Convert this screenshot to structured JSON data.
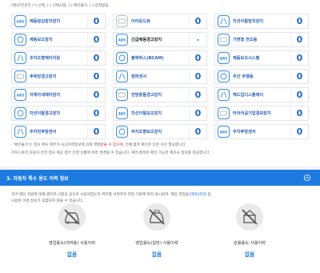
{
  "legend": "(제)안전운전 (*) 선택, (-) 선택사항, (-) 확인불가, (-) 장착없음",
  "options": [
    {
      "icon": "abs-icon",
      "label": "제동잠김방지장치",
      "count": "0",
      "label_color": "blue"
    },
    {
      "icon": "display-icon",
      "label": "어라운드뷰",
      "count": "0",
      "label_color": "blue"
    },
    {
      "icon": "lane-keep-icon",
      "label": "차선이탈방지장치",
      "count": "0",
      "label_color": "blue"
    },
    {
      "icon": "brake-assist-icon",
      "label": "제동보조장치",
      "count": "0",
      "label_color": "blue"
    },
    {
      "icon": "emergency-brake-icon",
      "label": "긴급제동경고장치",
      "count": "-",
      "label_color": "black"
    },
    {
      "icon": "headlight-icon",
      "label": "가변형 전조등",
      "count": "0",
      "label_color": "blue"
    },
    {
      "icon": "stability-icon",
      "label": "주차조향제어지원",
      "count": "0",
      "label_color": "blue"
    },
    {
      "icon": "dashcam-icon",
      "label": "블랙박스(BCAM)",
      "count": "0",
      "label_color": "blue"
    },
    {
      "icon": "bcam-icon",
      "label": "제동보조시스템",
      "count": "0",
      "label_color": "blue"
    },
    {
      "icon": "rear-warning-icon",
      "label": "후측방경고장치",
      "count": "0",
      "label_color": "blue"
    },
    {
      "icon": "reverse-icon",
      "label": "범퍼센서",
      "count": "0",
      "label_color": "blue"
    },
    {
      "icon": "parking-icon",
      "label": "주간 주행등",
      "count": "0",
      "label_color": "blue"
    },
    {
      "icon": "tire-icon",
      "label": "차체자세제어장치",
      "count": "0",
      "label_color": "blue"
    },
    {
      "icon": "traffic-sign-icon",
      "label": "전방충돌경고장치",
      "count": "0",
      "label_color": "blue"
    },
    {
      "icon": "hud-icon",
      "label": "헤드업디스플레이",
      "count": "0",
      "label_color": "blue"
    },
    {
      "icon": "lane-depart-icon",
      "label": "차선이탈경고장치",
      "count": "0",
      "label_color": "blue"
    },
    {
      "icon": "lane-assist-icon",
      "label": "차선이탈보조장치",
      "count": "0",
      "label_color": "blue"
    },
    {
      "icon": "tpms-icon",
      "label": "타이어공기압경보장치",
      "count": "0",
      "label_color": "blue"
    },
    {
      "icon": "sensor-icon",
      "label": "주차전후방센서",
      "count": "0",
      "label_color": "blue"
    },
    {
      "icon": "parking-assist-icon",
      "label": "주차조향보조장치",
      "count": "0",
      "label_color": "blue"
    },
    {
      "icon": "rear-sensor-icon",
      "label": "주차후방센서",
      "count": "0",
      "label_color": "blue"
    }
  ],
  "notes": {
    "line1_prefix": "· '확인불가'는 정보 확보 여부가 사고이력정보에 의해 영향",
    "line1_red": "받을 수 있으며",
    "line1_suffix": ", 전체 품목 확인은 다른 수단 필요합니다.",
    "line2": "카히스토리 자동차 안전 정보 제공 업무 진행 상황에 따라 변경될 수 있습니다. 여러 품목은 확인 가능한 제조사 정보를 제공합니다."
  },
  "section2": {
    "title": "3. 자동차 특수 용도 이력 정보",
    "desc_line1_prefix": "과거 해당 차량에 대해 렌터카·사업용 용도로 사용되었는지 여부를 보여주며 관련 기준에 따라 표시되며, 해당 영업용",
    "desc_line1_blue": "(대여)/관용",
    "desc_line1_suffix": " 등",
    "desc_line2": "사용된 이력 정보가 포함되지 않을 수 있습니다."
  },
  "usage_items": [
    {
      "icon": "rental-car-icon",
      "label": "영업용도(대여용) 사용이력",
      "value": "없음"
    },
    {
      "icon": "business-car-icon",
      "label": "영업용도(일반) 사용이력",
      "value": "없음"
    },
    {
      "icon": "government-car-icon",
      "label": "관용용도 사용이력",
      "value": "없음"
    }
  ]
}
